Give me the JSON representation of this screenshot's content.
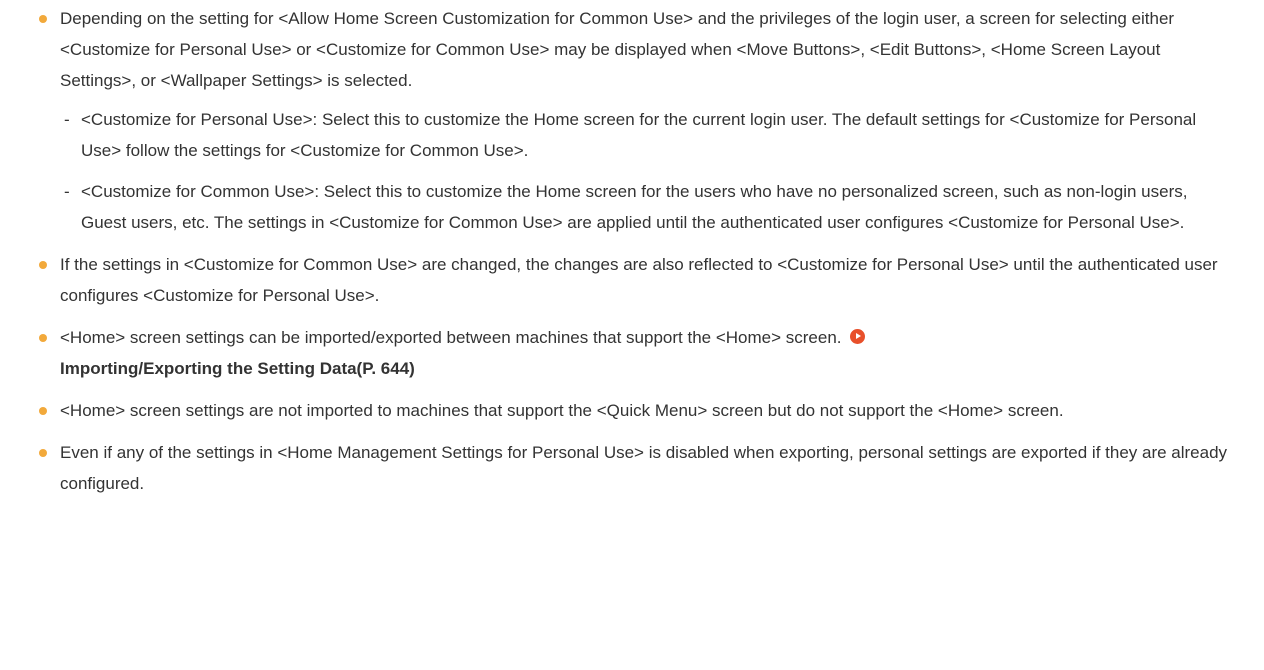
{
  "colors": {
    "bullet": "#f2a93b",
    "link_arrow": "#e8502b",
    "text": "#333333"
  },
  "bullets": [
    {
      "text": "Depending on the setting for <Allow Home Screen Customization for Common Use> and the privileges of the login user, a screen for selecting either <Customize for Personal Use> or <Customize for Common Use> may be displayed when <Move Buttons>, <Edit Buttons>, <Home Screen Layout Settings>, or <Wallpaper Settings> is selected.",
      "sub_items": [
        "<Customize for Personal Use>: Select this to customize the Home screen for the current login user. The default settings for <Customize for Personal Use> follow the settings for <Customize for Common Use>.",
        "<Customize for Common Use>: Select this to customize the Home screen for the users who have no personalized screen, such as non-login users, Guest users, etc. The settings in <Customize for Common Use> are applied until the authenticated user configures <Customize for Personal Use>."
      ]
    },
    {
      "text": "If the settings in <Customize for Common Use> are changed, the changes are also reflected to <Customize for Personal Use> until the authenticated user configures <Customize for Personal Use>."
    },
    {
      "text": "<Home> screen settings can be imported/exported between machines that support the <Home> screen.",
      "link_text": "Importing/Exporting the Setting Data(P. 644)",
      "link_icon": "arrow-circle-icon"
    },
    {
      "text": "<Home> screen settings are not imported to machines that support the <Quick Menu> screen but do not support the <Home> screen."
    },
    {
      "text": "Even if any of the settings in <Home Management Settings for Personal Use> is disabled when exporting, personal settings are exported if they are already configured."
    }
  ]
}
